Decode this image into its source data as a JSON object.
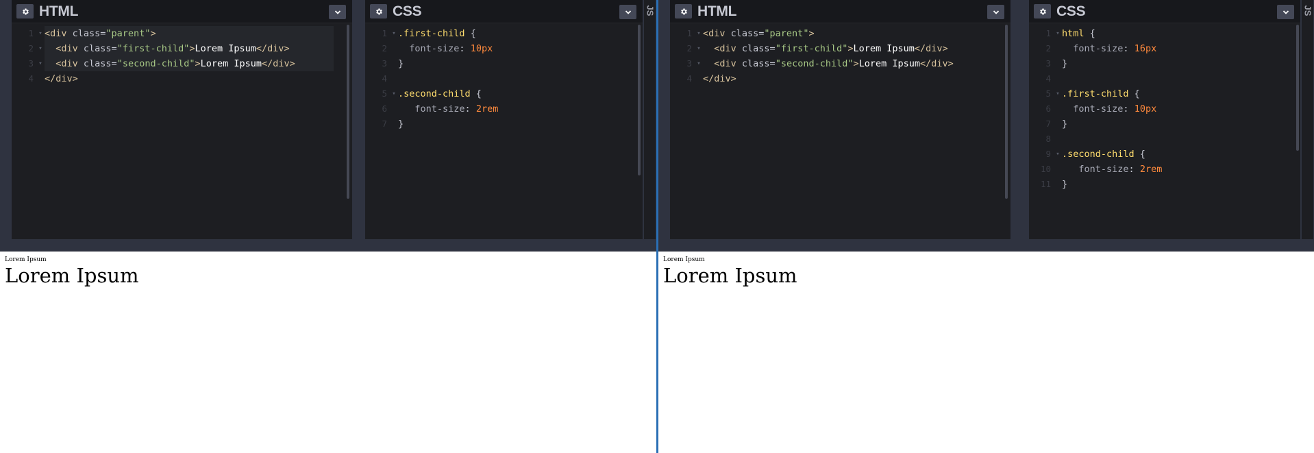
{
  "left": {
    "html_panel": {
      "title": "HTML",
      "lines": [
        {
          "n": "1",
          "fold": "▾",
          "parts": [
            [
              "t-tag",
              "<div "
            ],
            [
              "t-attr",
              "class"
            ],
            [
              "t-punct",
              "="
            ],
            [
              "t-val",
              "\"parent\""
            ],
            [
              "t-tag",
              ">"
            ]
          ]
        },
        {
          "n": "2",
          "fold": "▾",
          "parts": [
            [
              "t-txt",
              "  "
            ],
            [
              "t-tag",
              "<div "
            ],
            [
              "t-attr",
              "class"
            ],
            [
              "t-punct",
              "="
            ],
            [
              "t-val",
              "\"first-child\""
            ],
            [
              "t-tag",
              ">"
            ],
            [
              "t-text",
              "Lorem Ipsum"
            ],
            [
              "t-tag",
              "</div>"
            ]
          ]
        },
        {
          "n": "3",
          "fold": "▾",
          "parts": [
            [
              "t-txt",
              "  "
            ],
            [
              "t-tag",
              "<div "
            ],
            [
              "t-attr",
              "class"
            ],
            [
              "t-punct",
              "="
            ],
            [
              "t-val",
              "\"second-child\""
            ],
            [
              "t-tag",
              ">"
            ],
            [
              "t-text",
              "Lorem Ipsum"
            ],
            [
              "t-tag",
              "</div>"
            ]
          ]
        },
        {
          "n": "4",
          "fold": "",
          "parts": [
            [
              "t-tag",
              "</div>"
            ]
          ]
        }
      ]
    },
    "css_panel": {
      "title": "CSS",
      "lines": [
        {
          "n": "1",
          "fold": "▾",
          "parts": [
            [
              "t-sel",
              ".first-child "
            ],
            [
              "t-punct",
              "{"
            ]
          ]
        },
        {
          "n": "2",
          "fold": "",
          "parts": [
            [
              "t-txt",
              "  "
            ],
            [
              "t-prop",
              "font-size"
            ],
            [
              "t-punct",
              ": "
            ],
            [
              "t-num",
              "10px"
            ]
          ]
        },
        {
          "n": "3",
          "fold": "",
          "parts": [
            [
              "t-punct",
              "}"
            ]
          ]
        },
        {
          "n": "4",
          "fold": "",
          "parts": []
        },
        {
          "n": "5",
          "fold": "▾",
          "parts": [
            [
              "t-sel",
              ".second-child "
            ],
            [
              "t-punct",
              "{"
            ]
          ]
        },
        {
          "n": "6",
          "fold": "",
          "parts": [
            [
              "t-txt",
              "   "
            ],
            [
              "t-prop",
              "font-size"
            ],
            [
              "t-punct",
              ": "
            ],
            [
              "t-num",
              "2rem"
            ]
          ]
        },
        {
          "n": "7",
          "fold": "",
          "parts": [
            [
              "t-punct",
              "}"
            ]
          ]
        }
      ]
    },
    "js_label": "JS",
    "result": {
      "small": "Lorem Ipsum",
      "big": "Lorem Ipsum"
    }
  },
  "right": {
    "html_panel": {
      "title": "HTML",
      "lines": [
        {
          "n": "1",
          "fold": "▾",
          "parts": [
            [
              "t-tag",
              "<div "
            ],
            [
              "t-attr",
              "class"
            ],
            [
              "t-punct",
              "="
            ],
            [
              "t-val",
              "\"parent\""
            ],
            [
              "t-tag",
              ">"
            ]
          ]
        },
        {
          "n": "2",
          "fold": "▾",
          "parts": [
            [
              "t-txt",
              "  "
            ],
            [
              "t-tag",
              "<div "
            ],
            [
              "t-attr",
              "class"
            ],
            [
              "t-punct",
              "="
            ],
            [
              "t-val",
              "\"first-child\""
            ],
            [
              "t-tag",
              ">"
            ],
            [
              "t-text",
              "Lorem Ipsum"
            ],
            [
              "t-tag",
              "</div>"
            ]
          ]
        },
        {
          "n": "3",
          "fold": "▾",
          "parts": [
            [
              "t-txt",
              "  "
            ],
            [
              "t-tag",
              "<div "
            ],
            [
              "t-attr",
              "class"
            ],
            [
              "t-punct",
              "="
            ],
            [
              "t-val",
              "\"second-child\""
            ],
            [
              "t-tag",
              ">"
            ],
            [
              "t-text",
              "Lorem Ipsum"
            ],
            [
              "t-tag",
              "</div>"
            ]
          ]
        },
        {
          "n": "4",
          "fold": "",
          "parts": [
            [
              "t-tag",
              "</div>"
            ]
          ]
        }
      ]
    },
    "css_panel": {
      "title": "CSS",
      "lines": [
        {
          "n": "1",
          "fold": "▾",
          "parts": [
            [
              "t-sel",
              "html "
            ],
            [
              "t-punct",
              "{"
            ]
          ]
        },
        {
          "n": "2",
          "fold": "",
          "parts": [
            [
              "t-txt",
              "  "
            ],
            [
              "t-prop",
              "font-size"
            ],
            [
              "t-punct",
              ": "
            ],
            [
              "t-num",
              "16px"
            ]
          ]
        },
        {
          "n": "3",
          "fold": "",
          "parts": [
            [
              "t-punct",
              "}"
            ]
          ]
        },
        {
          "n": "4",
          "fold": "",
          "parts": []
        },
        {
          "n": "5",
          "fold": "▾",
          "parts": [
            [
              "t-sel",
              ".first-child "
            ],
            [
              "t-punct",
              "{"
            ]
          ]
        },
        {
          "n": "6",
          "fold": "",
          "parts": [
            [
              "t-txt",
              "  "
            ],
            [
              "t-prop",
              "font-size"
            ],
            [
              "t-punct",
              ": "
            ],
            [
              "t-num",
              "10px"
            ]
          ]
        },
        {
          "n": "7",
          "fold": "",
          "parts": [
            [
              "t-punct",
              "}"
            ]
          ]
        },
        {
          "n": "8",
          "fold": "",
          "parts": []
        },
        {
          "n": "9",
          "fold": "▾",
          "parts": [
            [
              "t-sel",
              ".second-child "
            ],
            [
              "t-punct",
              "{"
            ]
          ]
        },
        {
          "n": "10",
          "fold": "",
          "parts": [
            [
              "t-txt",
              "   "
            ],
            [
              "t-prop",
              "font-size"
            ],
            [
              "t-punct",
              ": "
            ],
            [
              "t-num",
              "2rem"
            ]
          ]
        },
        {
          "n": "11",
          "fold": "",
          "parts": [
            [
              "t-punct",
              "}"
            ]
          ]
        }
      ]
    },
    "js_label": "JS",
    "result": {
      "small": "Lorem Ipsum",
      "big": "Lorem Ipsum"
    }
  },
  "icons": {
    "settings": "gear-icon",
    "menu": "chevron-down-icon"
  },
  "colors": {
    "editor_bg": "#1d1e22",
    "header_bg": "#17181c",
    "divider": "#2a6fb5",
    "button_bg": "#444857"
  }
}
